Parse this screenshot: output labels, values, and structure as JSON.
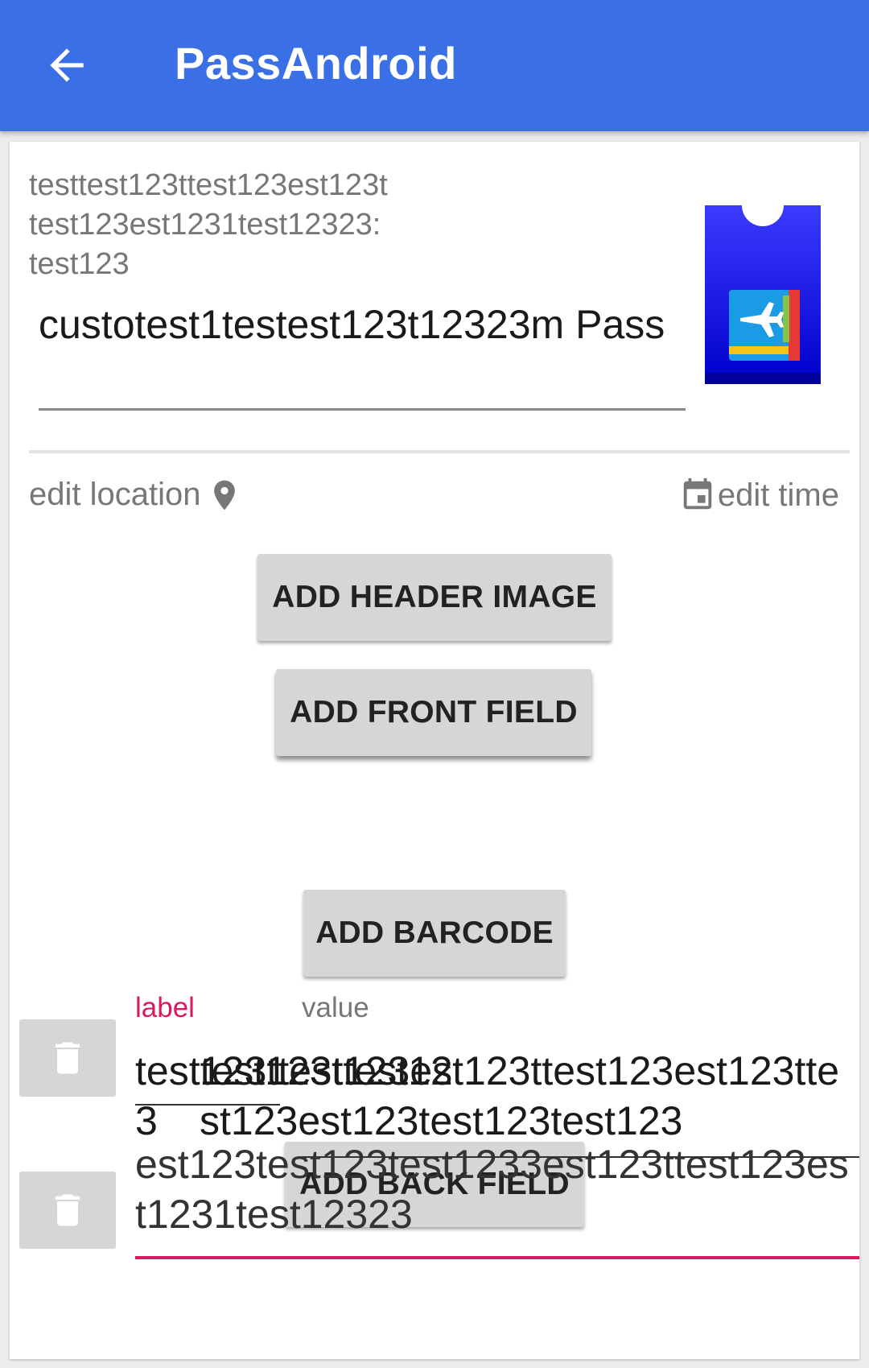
{
  "appbar": {
    "title": "PassAndroid",
    "back_icon": "arrow-left-icon",
    "background_color": "#3a6fe6"
  },
  "pass": {
    "subtitle": "testtest123ttest123est123t test123est1231test12323: test123",
    "title": "custotest1testest123t12323m Pass",
    "thumbnail_icon": "boarding-pass-icon"
  },
  "actions": {
    "edit_location": "edit location",
    "location_icon": "map-pin-icon",
    "edit_time": "edit time",
    "time_icon": "calendar-icon"
  },
  "buttons": {
    "add_header_image": "ADD HEADER IMAGE",
    "add_front_field": "ADD FRONT FIELD",
    "add_barcode": "ADD BARCODE",
    "add_back_field": "ADD BACK FIELD"
  },
  "back_fields": {
    "label_hint": "label",
    "value_hint": "value",
    "label_hint_color": "#d81b60",
    "row1_label": "testtest123ttest123",
    "row1_value": "123ttest123est123ttest123est123ttest123est123test123test123",
    "row2_value": "est123test123test1233est123ttest123est1231test12323",
    "trash_icon": "trash-icon"
  },
  "colors": {
    "accent": "#d81b60",
    "button_bg": "#d6d6d6"
  }
}
